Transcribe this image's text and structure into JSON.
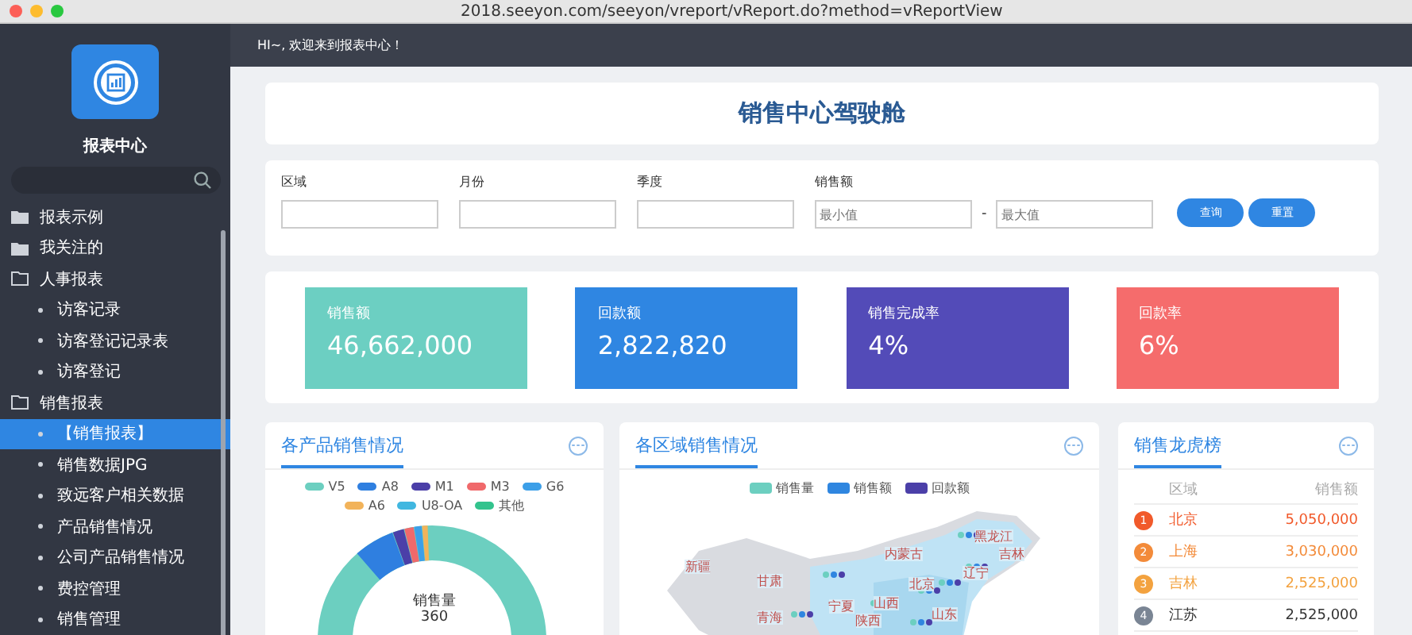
{
  "browser": {
    "url": "2018.seeyon.com/seeyon/vreport/vReport.do?method=vReportView"
  },
  "sidebar": {
    "title": "报表中心",
    "items": [
      {
        "label": "报表示例",
        "expanded": false,
        "selected": false
      },
      {
        "label": "我关注的",
        "expanded": false,
        "selected": false
      },
      {
        "label": "人事报表",
        "expanded": true,
        "selected": false,
        "children": [
          {
            "label": "访客记录",
            "selected": false
          },
          {
            "label": "访客登记记录表",
            "selected": false
          },
          {
            "label": "访客登记",
            "selected": false
          }
        ]
      },
      {
        "label": "销售报表",
        "expanded": true,
        "selected": false,
        "children": [
          {
            "label": "【销售报表】",
            "selected": true
          },
          {
            "label": "销售数据JPG",
            "selected": false
          },
          {
            "label": "致远客户相关数据",
            "selected": false
          },
          {
            "label": "产品销售情况",
            "selected": false
          },
          {
            "label": "公司产品销售情况",
            "selected": false
          },
          {
            "label": "费控管理",
            "selected": false
          },
          {
            "label": "销售管理",
            "selected": false
          }
        ]
      }
    ]
  },
  "header": {
    "greeting": "HI~, 欢迎来到报表中心！"
  },
  "page_title": "销售中心驾驶舱",
  "filters": [
    {
      "label": "区域",
      "kind": "single"
    },
    {
      "label": "月份",
      "kind": "single"
    },
    {
      "label": "季度",
      "kind": "single"
    },
    {
      "label": "销售额",
      "kind": "range",
      "min_placeholder": "最小值",
      "separator": "-",
      "max_placeholder": "最大值"
    }
  ],
  "buttons": [
    "查询",
    "重置"
  ],
  "kpis": [
    {
      "label": "销售额",
      "value": "46,662,000",
      "color": "#6ccfc2"
    },
    {
      "label": "回款额",
      "value": "2,822,820",
      "color": "#2f86e2"
    },
    {
      "label": "销售完成率",
      "value": "4%",
      "color": "#534bb8"
    },
    {
      "label": "回款率",
      "value": "6%",
      "color": "#f56c6c"
    }
  ],
  "product_panel": {
    "title": "各产品销售情况",
    "legend": [
      {
        "name": "V5",
        "color": "#6ccfc0"
      },
      {
        "name": "A8",
        "color": "#2f7fe0"
      },
      {
        "name": "M1",
        "color": "#4b3fa8"
      },
      {
        "name": "M3",
        "color": "#f0696b"
      },
      {
        "name": "G6",
        "color": "#3c9fe8"
      },
      {
        "name": "A6",
        "color": "#f2b35a"
      },
      {
        "name": "U8-OA",
        "color": "#41b7e0"
      },
      {
        "name": "其他",
        "color": "#33c38d"
      }
    ],
    "center_label": "销售量",
    "center_value": "360"
  },
  "region_panel": {
    "title": "各区域销售情况",
    "legend": [
      {
        "name": "销售量",
        "color": "#6ccfc0"
      },
      {
        "name": "销售额",
        "color": "#2f86e0"
      },
      {
        "name": "回款额",
        "color": "#4b3fa8"
      }
    ],
    "map_labels": [
      {
        "name": "新疆"
      },
      {
        "name": "甘肃"
      },
      {
        "name": "青海"
      },
      {
        "name": "内蒙古"
      },
      {
        "name": "黑龙江"
      },
      {
        "name": "吉林"
      },
      {
        "name": "辽宁"
      },
      {
        "name": "北京"
      },
      {
        "name": "宁夏"
      },
      {
        "name": "山西"
      },
      {
        "name": "陕西"
      },
      {
        "name": "山东"
      }
    ]
  },
  "ranking": {
    "title": "销售龙虎榜",
    "columns": [
      "区域",
      "销售额"
    ],
    "rows": [
      {
        "rank": "1",
        "region": "北京",
        "amount": "5,050,000",
        "color": "#f15a2b"
      },
      {
        "rank": "2",
        "region": "上海",
        "amount": "3,030,000",
        "color": "#f38b3a"
      },
      {
        "rank": "3",
        "region": "吉林",
        "amount": "2,525,000",
        "color": "#f3a23f"
      },
      {
        "rank": "4",
        "region": "江苏",
        "amount": "2,525,000",
        "color": "#7a8594"
      }
    ]
  }
}
